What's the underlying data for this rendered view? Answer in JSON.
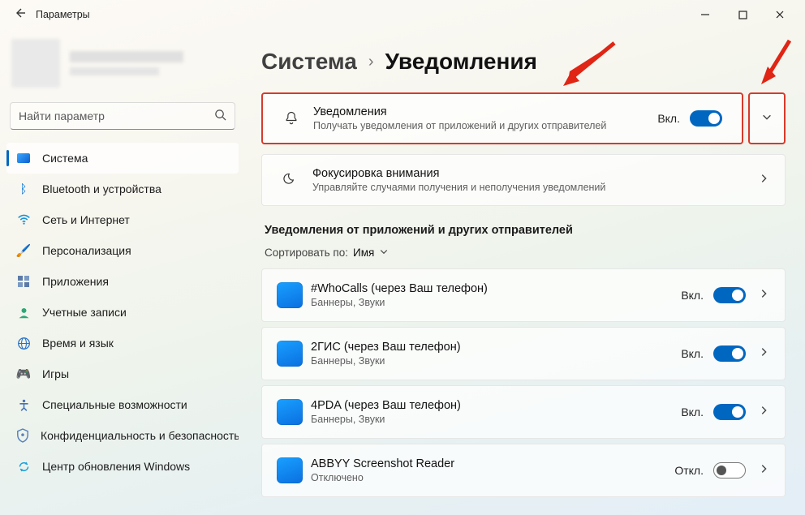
{
  "window": {
    "title": "Параметры",
    "controls": {
      "minimize": "—",
      "maximize": "□",
      "close": "✕"
    }
  },
  "search": {
    "placeholder": "Найти параметр"
  },
  "sidebar": {
    "items": [
      {
        "label": "Система",
        "icon": "display",
        "active": true
      },
      {
        "label": "Bluetooth и устройства",
        "icon": "bluetooth"
      },
      {
        "label": "Сеть и Интернет",
        "icon": "wifi"
      },
      {
        "label": "Персонализация",
        "icon": "brush"
      },
      {
        "label": "Приложения",
        "icon": "apps"
      },
      {
        "label": "Учетные записи",
        "icon": "account"
      },
      {
        "label": "Время и язык",
        "icon": "globe"
      },
      {
        "label": "Игры",
        "icon": "game"
      },
      {
        "label": "Специальные возможности",
        "icon": "access"
      },
      {
        "label": "Конфиденциальность и безопасность",
        "icon": "shield"
      },
      {
        "label": "Центр обновления Windows",
        "icon": "update"
      }
    ]
  },
  "breadcrumb": {
    "parent": "Система",
    "sep": "›",
    "current": "Уведомления"
  },
  "cards": {
    "notifications": {
      "title": "Уведомления",
      "subtitle": "Получать уведомления от приложений и других отправителей",
      "status": "Вкл.",
      "on": true
    },
    "focus": {
      "title": "Фокусировка внимания",
      "subtitle": "Управляйте случаями получения и неполучения уведомлений"
    }
  },
  "section": {
    "title": "Уведомления от приложений и других отправителей",
    "sort_label": "Сортировать по:",
    "sort_value": "Имя"
  },
  "status_labels": {
    "on": "Вкл.",
    "off": "Откл."
  },
  "apps": [
    {
      "name": "#WhoCalls (через Ваш телефон)",
      "sub": "Баннеры, Звуки",
      "status": "Вкл.",
      "on": true
    },
    {
      "name": "2ГИС (через Ваш телефон)",
      "sub": "Баннеры, Звуки",
      "status": "Вкл.",
      "on": true
    },
    {
      "name": "4PDA (через Ваш телефон)",
      "sub": "Баннеры, Звуки",
      "status": "Вкл.",
      "on": true
    },
    {
      "name": "ABBYY Screenshot Reader",
      "sub": "Отключено",
      "status": "Откл.",
      "on": false
    }
  ]
}
